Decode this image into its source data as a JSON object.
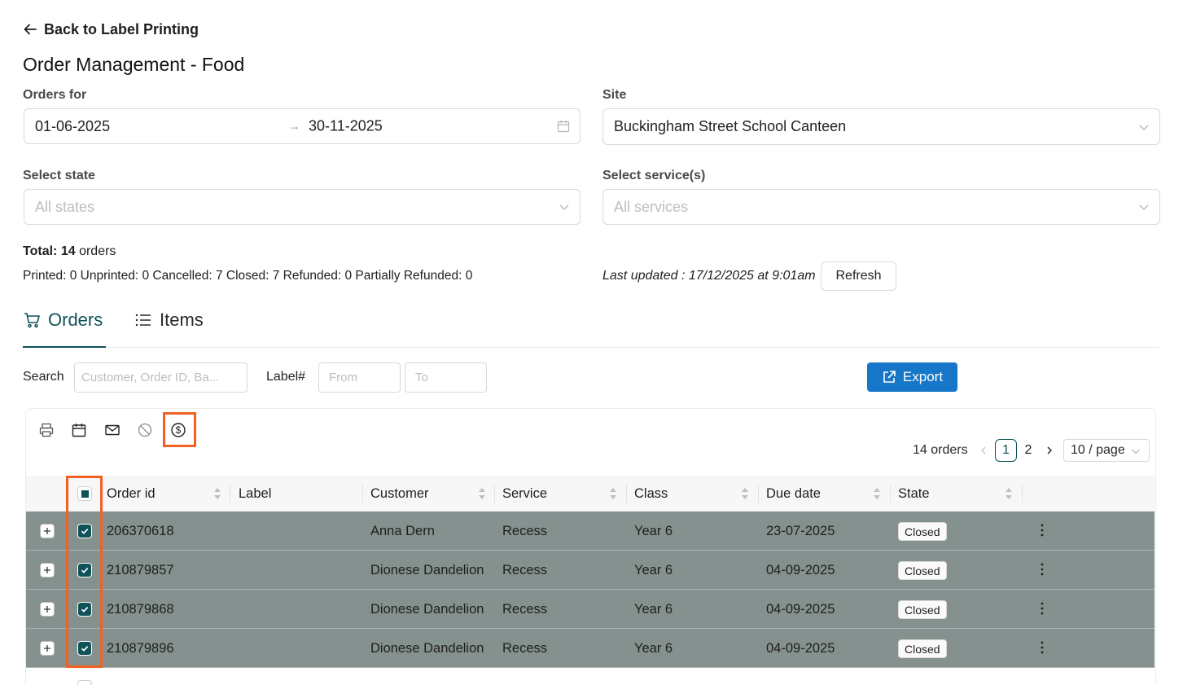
{
  "back_link": "Back to Label Printing",
  "page_title": "Order Management - Food",
  "filters": {
    "orders_for_label": "Orders for",
    "date_start": "01-06-2025",
    "date_separator": "→",
    "date_end": "30-11-2025",
    "site_label": "Site",
    "site_value": "Buckingham Street School Canteen",
    "state_label": "Select state",
    "state_placeholder": "All states",
    "service_label": "Select service(s)",
    "service_placeholder": "All services"
  },
  "summary": {
    "total_prefix": "Total:",
    "total_count": "14",
    "total_suffix": "orders",
    "stats": "Printed: 0 Unprinted: 0 Cancelled: 7 Closed: 7 Refunded: 0 Partially Refunded: 0",
    "last_updated": "Last updated : 17/12/2025 at 9:01am",
    "refresh_label": "Refresh"
  },
  "tabs": [
    {
      "label": "Orders",
      "icon": "cart-icon",
      "active": true
    },
    {
      "label": "Items",
      "icon": "list-icon",
      "active": false
    }
  ],
  "search": {
    "label": "Search",
    "placeholder": "Customer, Order ID, Ba...",
    "label_hash": "Label#",
    "from_placeholder": "From",
    "to_placeholder": "To",
    "export_label": "Export"
  },
  "toolbar": {
    "icons": [
      "printer-icon",
      "calendar-icon",
      "mail-icon",
      "cancel-icon",
      "dollar-circle-icon"
    ]
  },
  "pagination": {
    "total_text": "14 orders",
    "pages": [
      "1",
      "2"
    ],
    "current_page": "1",
    "page_size": "10 / page"
  },
  "table": {
    "columns": [
      "Order id",
      "Label",
      "Customer",
      "Service",
      "Class",
      "Due date",
      "State"
    ],
    "rows": [
      {
        "order_id": "206370618",
        "label": "",
        "customer": "Anna Dern",
        "service": "Recess",
        "class": "Year 6",
        "due_date": "23-07-2025",
        "state": "Closed",
        "selected": true
      },
      {
        "order_id": "210879857",
        "label": "",
        "customer": "Dionese Dandelion",
        "service": "Recess",
        "class": "Year 6",
        "due_date": "04-09-2025",
        "state": "Closed",
        "selected": true
      },
      {
        "order_id": "210879868",
        "label": "",
        "customer": "Dionese Dandelion",
        "service": "Recess",
        "class": "Year 6",
        "due_date": "04-09-2025",
        "state": "Closed",
        "selected": true
      },
      {
        "order_id": "210879896",
        "label": "",
        "customer": "Dionese Dandelion",
        "service": "Recess",
        "class": "Year 6",
        "due_date": "04-09-2025",
        "state": "Closed",
        "selected": true
      }
    ]
  },
  "colors": {
    "accent": "#0f5257",
    "primary_button": "#1677c8",
    "selected_row": "#84918e",
    "highlight": "#f26122"
  }
}
